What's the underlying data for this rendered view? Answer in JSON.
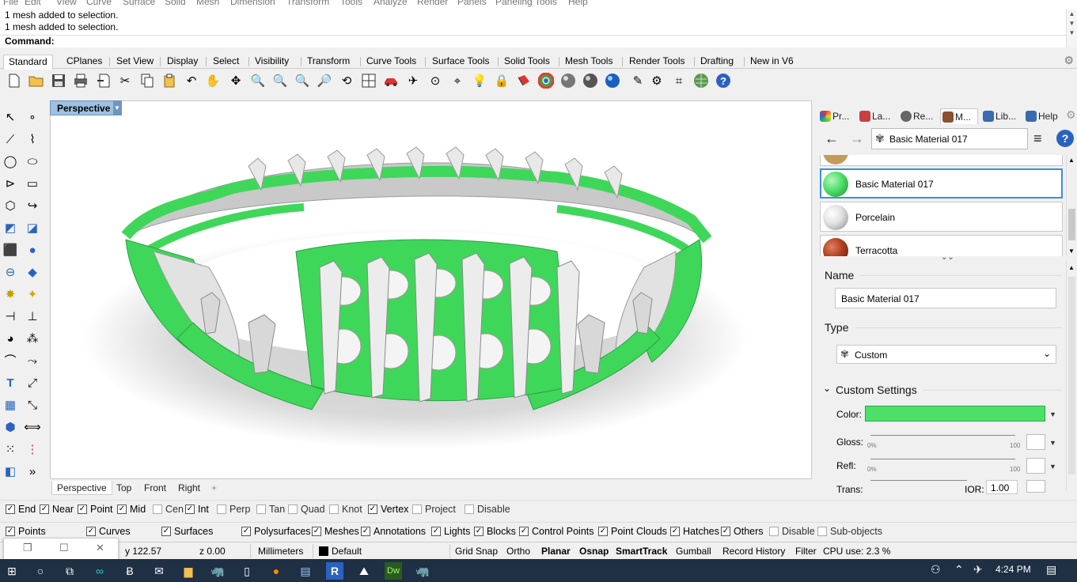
{
  "menu": [
    "File",
    "Edit",
    "View",
    "Curve",
    "Surface",
    "Solid",
    "Mesh",
    "Dimension",
    "Transform",
    "Tools",
    "Analyze",
    "Render",
    "Panels",
    "Paneling Tools",
    "Help"
  ],
  "history": [
    "1 mesh added to selection.",
    "1 mesh added to selection."
  ],
  "command_label": "Command:",
  "tabs": [
    "Standard",
    "CPlanes",
    "Set View",
    "Display",
    "Select",
    "Visibility",
    "Transform",
    "Curve Tools",
    "Surface Tools",
    "Solid Tools",
    "Mesh Tools",
    "Render Tools",
    "Drafting",
    "New in V6"
  ],
  "active_tab": "Standard",
  "toolbar_icons": [
    "new-icon",
    "open-icon",
    "save-icon",
    "print-icon",
    "import-icon",
    "cut-icon",
    "copy-icon",
    "paste-icon",
    "undo-icon",
    "pan-hand-icon",
    "rotate-view-icon",
    "zoom-icon",
    "zoom-window-icon",
    "zoom-extents-icon",
    "zoom-selected-icon",
    "rotate-camera-icon",
    "four-viewports-icon",
    "car-icon",
    "satellite-icon",
    "target-icon",
    "pin-icon",
    "light-bulb-icon",
    "lock-icon",
    "bucket-icon",
    "color-wheel-icon",
    "sphere-grey-icon",
    "sphere-dark-icon",
    "sphere-blue-icon",
    "pencil-icon",
    "gear-icon",
    "crop-icon",
    "globe-icon",
    "help-icon"
  ],
  "left_icons": [
    "select-arrow-icon",
    "point-icon",
    "polyline-icon",
    "curve-points-icon",
    "circle-icon",
    "ellipse-icon",
    "arc-icon",
    "rectangle-icon",
    "polygon-icon",
    "curve-tool-icon",
    "surface-icon",
    "surface-edit-icon",
    "box-icon",
    "sphere-icon",
    "cylinder-icon",
    "plane-icon",
    "transform-icon",
    "explode-icon",
    "split-icon",
    "extend-icon",
    "boolean-union-icon",
    "boolean-diff-icon",
    "fillet-icon",
    "offset-icon",
    "text-icon",
    "dimension-icon",
    "grid-array-icon",
    "move-icon",
    "block-icon",
    "measure-icon",
    "array-icon",
    "array-curve-icon",
    "scale-icon",
    "more-icon"
  ],
  "viewport": {
    "title": "Perspective",
    "tabs": [
      "Perspective",
      "Top",
      "Front",
      "Right"
    ],
    "add": "+"
  },
  "panel": {
    "tabs": [
      {
        "label": "Pr...",
        "color": "#e04040"
      },
      {
        "label": "La...",
        "color": "#c84040"
      },
      {
        "label": "Re...",
        "color": "#555"
      },
      {
        "label": "M...",
        "color": "#8a5030"
      },
      {
        "label": "Lib...",
        "color": "#3a6ab0"
      },
      {
        "label": "Help",
        "color": "#3a6ab0"
      }
    ],
    "current_material": "Basic Material 017",
    "materials": [
      {
        "label": "Basic Material 017",
        "color": "#4ce166",
        "selected": true
      },
      {
        "label": "Porcelain",
        "color": "#e8e8e8",
        "selected": false
      },
      {
        "label": "Terracotta",
        "color": "#b04020",
        "selected": false
      }
    ],
    "name_label": "Name",
    "name_value": "Basic Material 017",
    "type_label": "Type",
    "type_value": "Custom",
    "section": "Custom Settings",
    "color_label": "Color:",
    "color": "#4ce166",
    "gloss_label": "Gloss:",
    "refl_label": "Refl:",
    "trans_label": "Trans:",
    "ior_label": "IOR:",
    "ior_value": "1.00",
    "tick_min": "0%",
    "tick_max": "100"
  },
  "osnaps": [
    {
      "label": "End",
      "on": true
    },
    {
      "label": "Near",
      "on": true
    },
    {
      "label": "Point",
      "on": true
    },
    {
      "label": "Mid",
      "on": true
    },
    {
      "label": "Cen",
      "on": false
    },
    {
      "label": "Int",
      "on": true
    },
    {
      "label": "Perp",
      "on": false
    },
    {
      "label": "Tan",
      "on": false
    },
    {
      "label": "Quad",
      "on": false
    },
    {
      "label": "Knot",
      "on": false
    },
    {
      "label": "Vertex",
      "on": true
    },
    {
      "label": "Project",
      "on": false
    },
    {
      "label": "Disable",
      "on": false
    }
  ],
  "filters": [
    {
      "label": "Points",
      "on": true
    },
    {
      "label": "Curves",
      "on": true
    },
    {
      "label": "Surfaces",
      "on": true
    },
    {
      "label": "Polysurfaces",
      "on": true
    },
    {
      "label": "Meshes",
      "on": true
    },
    {
      "label": "Annotations",
      "on": true
    },
    {
      "label": "Lights",
      "on": true
    },
    {
      "label": "Blocks",
      "on": true
    },
    {
      "label": "Control Points",
      "on": true
    },
    {
      "label": "Point Clouds",
      "on": true
    },
    {
      "label": "Hatches",
      "on": true
    },
    {
      "label": "Others",
      "on": true
    },
    {
      "label": "Disable",
      "on": false
    },
    {
      "label": "Sub-objects",
      "on": false
    }
  ],
  "status": {
    "y": "y 122.57",
    "z": "z 0.00",
    "units": "Millimeters",
    "layer": "Default",
    "grid_snap": "Grid Snap",
    "ortho": "Ortho",
    "planar": "Planar",
    "osnap": "Osnap",
    "smarttrack": "SmartTrack",
    "gumball": "Gumball",
    "record_history": "Record History",
    "filter": "Filter",
    "cpu": "CPU use: 2.3 %"
  },
  "taskbar": {
    "time": "4:24 PM"
  }
}
